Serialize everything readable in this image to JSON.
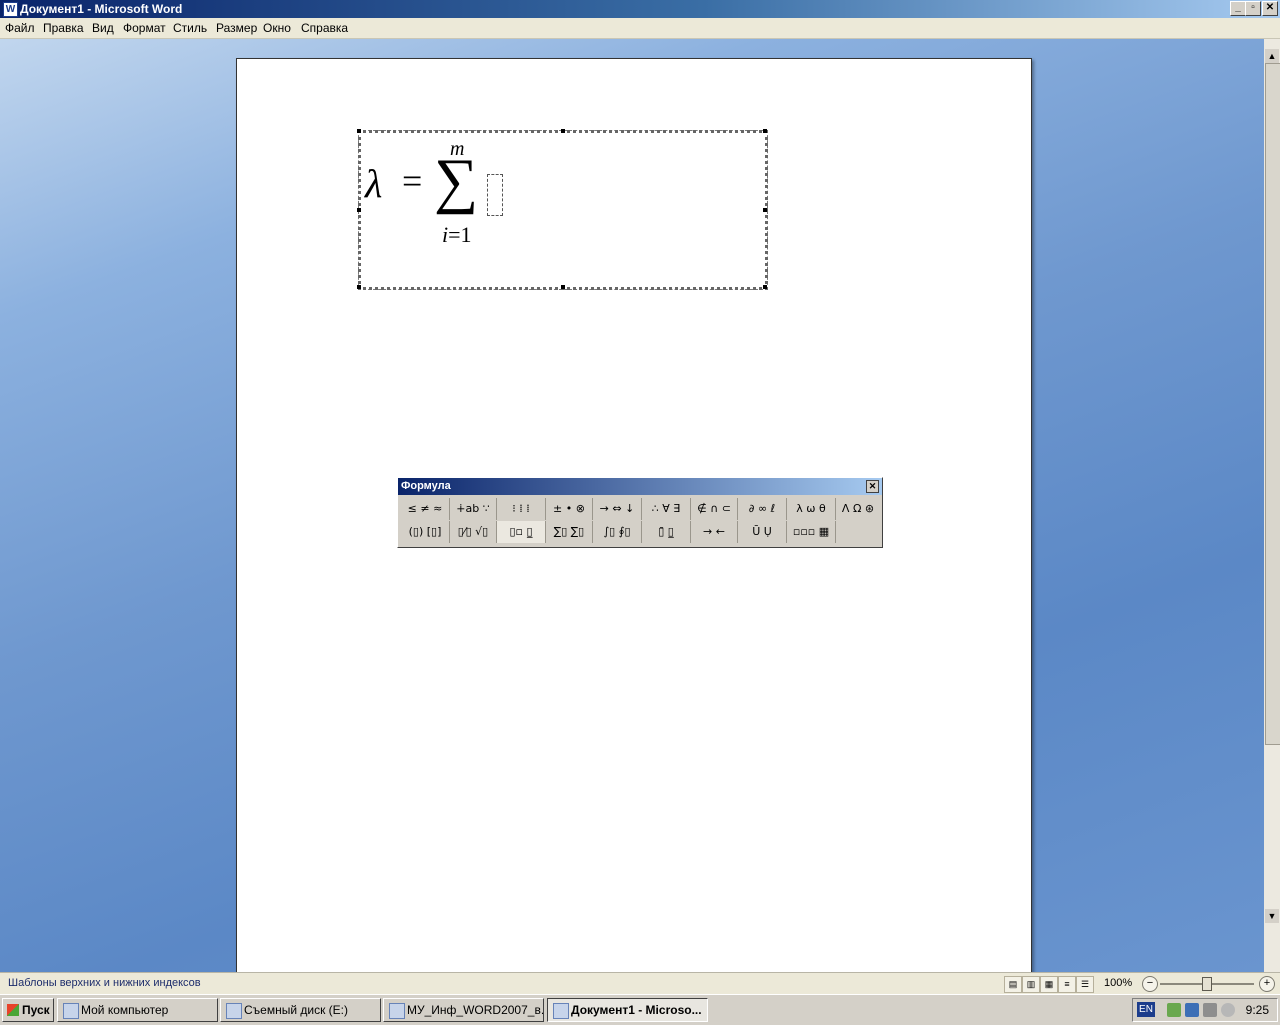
{
  "window": {
    "title": "Документ1 - Microsoft Word",
    "app_icon": "W",
    "buttons": {
      "minimize": "_",
      "restore": "▫",
      "close": "✕"
    }
  },
  "menu": [
    "Файл",
    "Правка",
    "Вид",
    "Формат",
    "Стиль",
    "Размер",
    "Окно",
    "Справка"
  ],
  "equation": {
    "lambda": "λ",
    "equals": "=",
    "sigma": "∑",
    "upper_limit": "m",
    "lower_var": "i",
    "lower_rest": "=1"
  },
  "formula_toolbar": {
    "title": "Формула",
    "close": "✕",
    "row1": [
      "≤ ≠ ≈",
      "∔ab ∵",
      "⁝ ⁞ ⁞",
      "± • ⊗",
      "→ ⇔ ↓",
      "∴ ∀ ∃",
      "∉ ∩ ⊂",
      "∂ ∞ ℓ",
      "λ ω θ",
      "Λ Ω ⊛"
    ],
    "row2": [
      "(▯) [▯]",
      "▯⁄▯ √▯",
      "▯▫ ▯̲",
      "∑▯ ∑▯",
      "∫▯ ∮▯",
      "▯̄ ▯̲",
      "→ ←",
      "Ū Ụ",
      "▫▫▫ ▦"
    ]
  },
  "status": {
    "text": "Шаблоны верхних и нижних индексов",
    "view_icons": [
      "▤",
      "▥",
      "▦",
      "≡",
      "☰"
    ],
    "zoom": "100%",
    "zoom_minus": "−",
    "zoom_plus": "+"
  },
  "taskbar": {
    "start": "Пуск",
    "tasks": [
      {
        "label": "Мой компьютер"
      },
      {
        "label": "Съемный диск (E:)"
      },
      {
        "label": "МУ_Инф_WORD2007_в..."
      },
      {
        "label": "Документ1 - Microso..."
      }
    ],
    "lang": "EN",
    "clock": "9:25"
  },
  "scrollbar": {
    "up": "▲",
    "down": "▼"
  }
}
